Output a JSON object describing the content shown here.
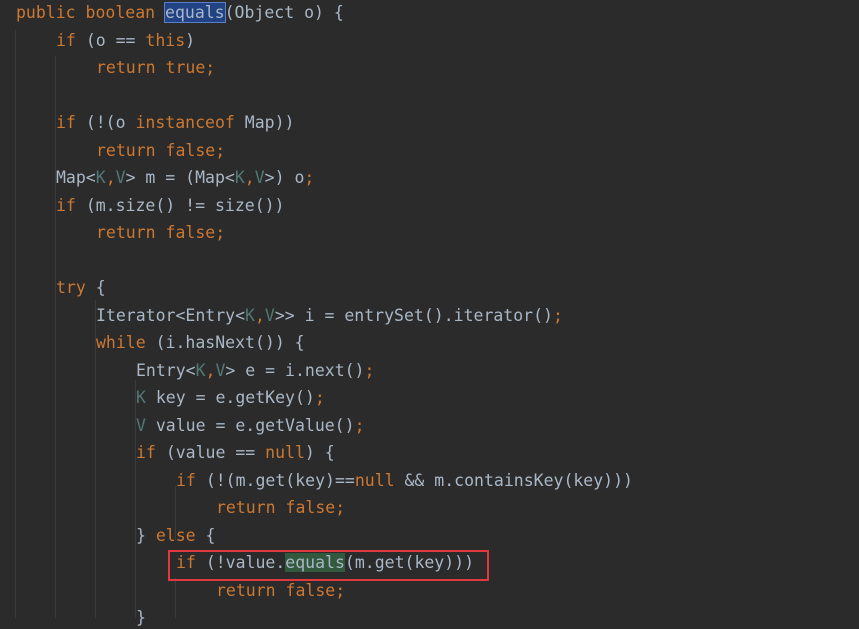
{
  "editor": {
    "lines": [
      {
        "indent": 0,
        "tokens": [
          {
            "t": "public boolean ",
            "c": "kw"
          },
          {
            "t": "equals",
            "c": "sel"
          },
          {
            "t": "(Object o) {",
            "c": "plain"
          }
        ]
      },
      {
        "indent": 1,
        "tokens": [
          {
            "t": "if ",
            "c": "kw"
          },
          {
            "t": "(o == ",
            "c": "plain"
          },
          {
            "t": "this",
            "c": "kw"
          },
          {
            "t": ")",
            "c": "plain"
          }
        ]
      },
      {
        "indent": 2,
        "tokens": [
          {
            "t": "return true",
            "c": "kw"
          },
          {
            "t": ";",
            "c": "semi"
          }
        ]
      },
      {
        "indent": 0,
        "tokens": []
      },
      {
        "indent": 1,
        "tokens": [
          {
            "t": "if ",
            "c": "kw"
          },
          {
            "t": "(!(o ",
            "c": "plain"
          },
          {
            "t": "instanceof ",
            "c": "kw"
          },
          {
            "t": "Map))",
            "c": "plain"
          }
        ]
      },
      {
        "indent": 2,
        "tokens": [
          {
            "t": "return false",
            "c": "kw"
          },
          {
            "t": ";",
            "c": "semi"
          }
        ]
      },
      {
        "indent": 1,
        "tokens": [
          {
            "t": "Map<",
            "c": "plain"
          },
          {
            "t": "K",
            "c": "type"
          },
          {
            "t": ",",
            "c": "semi"
          },
          {
            "t": "V",
            "c": "type"
          },
          {
            "t": "> m = (Map<",
            "c": "plain"
          },
          {
            "t": "K",
            "c": "type"
          },
          {
            "t": ",",
            "c": "semi"
          },
          {
            "t": "V",
            "c": "type"
          },
          {
            "t": ">) o",
            "c": "plain"
          },
          {
            "t": ";",
            "c": "semi"
          }
        ]
      },
      {
        "indent": 1,
        "tokens": [
          {
            "t": "if ",
            "c": "kw"
          },
          {
            "t": "(m.size() != size())",
            "c": "plain"
          }
        ]
      },
      {
        "indent": 2,
        "tokens": [
          {
            "t": "return false",
            "c": "kw"
          },
          {
            "t": ";",
            "c": "semi"
          }
        ]
      },
      {
        "indent": 0,
        "tokens": []
      },
      {
        "indent": 1,
        "tokens": [
          {
            "t": "try ",
            "c": "kw"
          },
          {
            "t": "{",
            "c": "plain"
          }
        ]
      },
      {
        "indent": 2,
        "tokens": [
          {
            "t": "Iterator<Entry<",
            "c": "plain"
          },
          {
            "t": "K",
            "c": "type"
          },
          {
            "t": ",",
            "c": "semi"
          },
          {
            "t": "V",
            "c": "type"
          },
          {
            "t": ">> i = entrySet().iterator()",
            "c": "plain"
          },
          {
            "t": ";",
            "c": "semi"
          }
        ]
      },
      {
        "indent": 2,
        "tokens": [
          {
            "t": "while ",
            "c": "kw"
          },
          {
            "t": "(i.hasNext()) {",
            "c": "plain"
          }
        ]
      },
      {
        "indent": 3,
        "tokens": [
          {
            "t": "Entry<",
            "c": "plain"
          },
          {
            "t": "K",
            "c": "type"
          },
          {
            "t": ",",
            "c": "semi"
          },
          {
            "t": "V",
            "c": "type"
          },
          {
            "t": "> e = i.next()",
            "c": "plain"
          },
          {
            "t": ";",
            "c": "semi"
          }
        ]
      },
      {
        "indent": 3,
        "tokens": [
          {
            "t": "K ",
            "c": "type"
          },
          {
            "t": "key = e.getKey()",
            "c": "plain"
          },
          {
            "t": ";",
            "c": "semi"
          }
        ]
      },
      {
        "indent": 3,
        "tokens": [
          {
            "t": "V ",
            "c": "type"
          },
          {
            "t": "value = e.getValue()",
            "c": "plain"
          },
          {
            "t": ";",
            "c": "semi"
          }
        ]
      },
      {
        "indent": 3,
        "tokens": [
          {
            "t": "if ",
            "c": "kw"
          },
          {
            "t": "(value == ",
            "c": "plain"
          },
          {
            "t": "null",
            "c": "kw"
          },
          {
            "t": ") {",
            "c": "plain"
          }
        ]
      },
      {
        "indent": 4,
        "tokens": [
          {
            "t": "if ",
            "c": "kw"
          },
          {
            "t": "(!(m.get(key)==",
            "c": "plain"
          },
          {
            "t": "null ",
            "c": "kw"
          },
          {
            "t": "&& m.containsKey(key)))",
            "c": "plain"
          }
        ]
      },
      {
        "indent": 5,
        "tokens": [
          {
            "t": "return false",
            "c": "kw"
          },
          {
            "t": ";",
            "c": "semi"
          }
        ]
      },
      {
        "indent": 3,
        "tokens": [
          {
            "t": "} ",
            "c": "plain"
          },
          {
            "t": "else ",
            "c": "kw"
          },
          {
            "t": "{",
            "c": "plain"
          }
        ]
      },
      {
        "indent": 4,
        "tokens": [
          {
            "t": "if ",
            "c": "kw"
          },
          {
            "t": "(!value.",
            "c": "plain"
          },
          {
            "t": "equals",
            "c": "usage"
          },
          {
            "t": "(m.get(key)))",
            "c": "plain"
          }
        ]
      },
      {
        "indent": 5,
        "tokens": [
          {
            "t": "return false",
            "c": "kw"
          },
          {
            "t": ";",
            "c": "semi"
          }
        ]
      },
      {
        "indent": 3,
        "tokens": [
          {
            "t": "}",
            "c": "plain"
          }
        ]
      }
    ]
  },
  "colors": {
    "background": "#2b2b2b",
    "keyword": "#cc7832",
    "identifier": "#a9b7c6",
    "type_param": "#507874",
    "highlight_box": "#e0393e"
  }
}
